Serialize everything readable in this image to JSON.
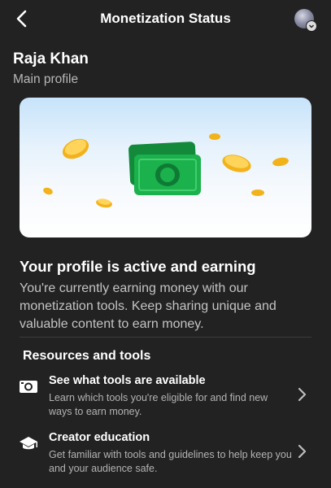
{
  "header": {
    "title": "Monetization Status",
    "back_icon": "back-arrow-icon",
    "avatar_icon": "profile-avatar"
  },
  "profile": {
    "name": "Raja Khan",
    "type": "Main profile"
  },
  "hero": {
    "illustration": "money-and-coins-illustration",
    "colors": {
      "sky": "#c7e3fa",
      "bill": "#1bb14c",
      "coin": "#f2b21a"
    }
  },
  "status": {
    "headline": "Your profile is active and earning",
    "description": "You're currently earning money with our monetization tools. Keep sharing unique and valuable content to earn money."
  },
  "resources": {
    "title": "Resources and tools",
    "items": [
      {
        "title": "See what tools are available",
        "description": "Learn which tools you're eligible for and find new ways to earn money.",
        "icon": "tools-camera-icon"
      },
      {
        "title": "Creator education",
        "description": "Get familiar with tools and guidelines to help keep you and your audience safe.",
        "icon": "education-cap-icon"
      }
    ]
  }
}
